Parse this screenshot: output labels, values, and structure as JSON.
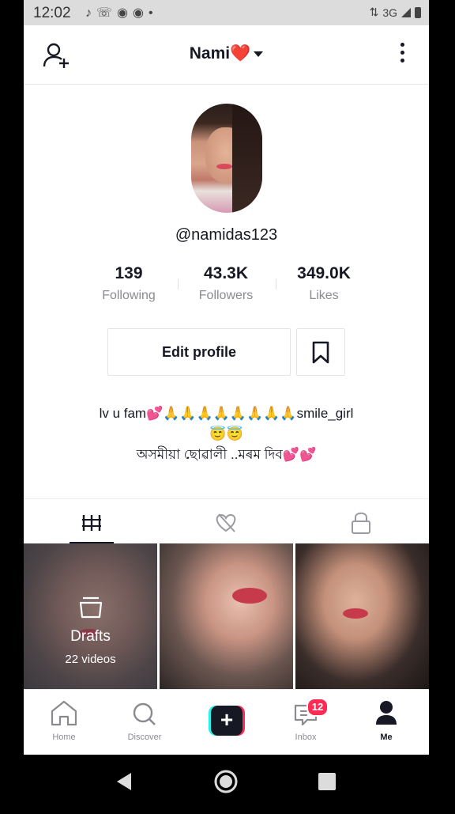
{
  "status_bar": {
    "time": "12:02",
    "network": "3G",
    "left_icons": [
      "tiktok-icon",
      "missed-call-icon",
      "chrome-icon",
      "chrome-icon",
      "dot-icon"
    ]
  },
  "header": {
    "title": "Nami❤️"
  },
  "profile": {
    "username": "@namidas123",
    "stats": [
      {
        "value": "139",
        "label": "Following"
      },
      {
        "value": "43.3K",
        "label": "Followers"
      },
      {
        "value": "349.0K",
        "label": "Likes"
      }
    ],
    "edit_label": "Edit profile",
    "bio_line1": "lv u  fam💕🙏🙏🙏🙏🙏🙏🙏🙏smile_girl",
    "bio_line2": "😇😇",
    "bio_line3": "অসমীয়া ছোৱালী ..মৰম দিব💕💕"
  },
  "tabs": [
    "videos-grid-icon",
    "liked-hidden-icon",
    "private-lock-icon"
  ],
  "videos": {
    "drafts_title": "Drafts",
    "drafts_count": "22 videos"
  },
  "bottom_nav": {
    "items": [
      {
        "label": "Home"
      },
      {
        "label": "Discover"
      },
      {
        "label": ""
      },
      {
        "label": "Inbox",
        "badge": "12"
      },
      {
        "label": "Me"
      }
    ]
  },
  "colors": {
    "accent_red": "#fe2c55",
    "accent_cyan": "#25f4ee",
    "text": "#161823",
    "muted": "#8a8b91"
  }
}
